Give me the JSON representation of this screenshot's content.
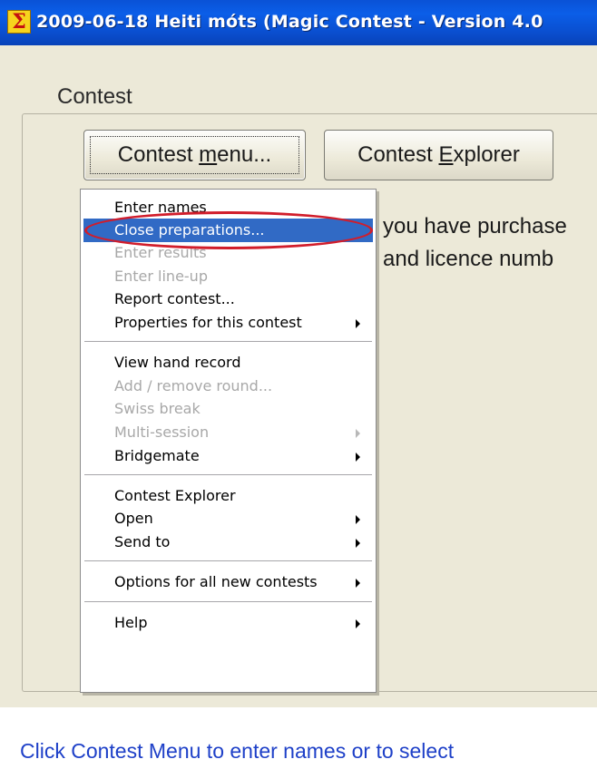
{
  "window": {
    "title": "2009-06-18  Heiti móts  (Magic Contest - Version 4.0",
    "icon": "sigma-app-icon",
    "icon_glyph": "Σ"
  },
  "group": {
    "legend": "Contest"
  },
  "buttons": {
    "contest_menu": {
      "pre": "Contest ",
      "key": "m",
      "post": "enu..."
    },
    "contest_explorer": {
      "pre": "Contest ",
      "key": "E",
      "post": "xplorer"
    }
  },
  "info": {
    "line1": "you have purchase",
    "line2": "and licence numb"
  },
  "status": "Click Contest Menu to enter names or to select",
  "menu": {
    "items": [
      {
        "label": "Enter names",
        "enabled": true
      },
      {
        "label": "Close preparations...",
        "enabled": true,
        "selected": true
      },
      {
        "label": "Enter results",
        "enabled": false
      },
      {
        "label": "Enter line-up",
        "enabled": false
      },
      {
        "label": "Report contest...",
        "enabled": true
      },
      {
        "label": "Properties for this contest",
        "enabled": true,
        "submenu": true
      },
      {
        "label": "View hand record",
        "enabled": true
      },
      {
        "label": "Add / remove round...",
        "enabled": false
      },
      {
        "label": "Swiss break",
        "enabled": false
      },
      {
        "label": "Multi-session",
        "enabled": false,
        "submenu": true
      },
      {
        "label": "Bridgemate",
        "enabled": true,
        "submenu": true
      },
      {
        "label": "Contest Explorer",
        "enabled": true
      },
      {
        "label": "Open",
        "enabled": true,
        "submenu": true
      },
      {
        "label": "Send to",
        "enabled": true,
        "submenu": true
      },
      {
        "label": "Options for all new contests",
        "enabled": true,
        "submenu": true
      },
      {
        "label": "Help",
        "enabled": true,
        "submenu": true
      }
    ]
  },
  "colors": {
    "titlebar": "#0b5ee8",
    "window_bg": "#ece9d8",
    "menu_highlight": "#316ac5",
    "annotation_oval": "#d11d2b",
    "status_text": "#1e40c8"
  }
}
